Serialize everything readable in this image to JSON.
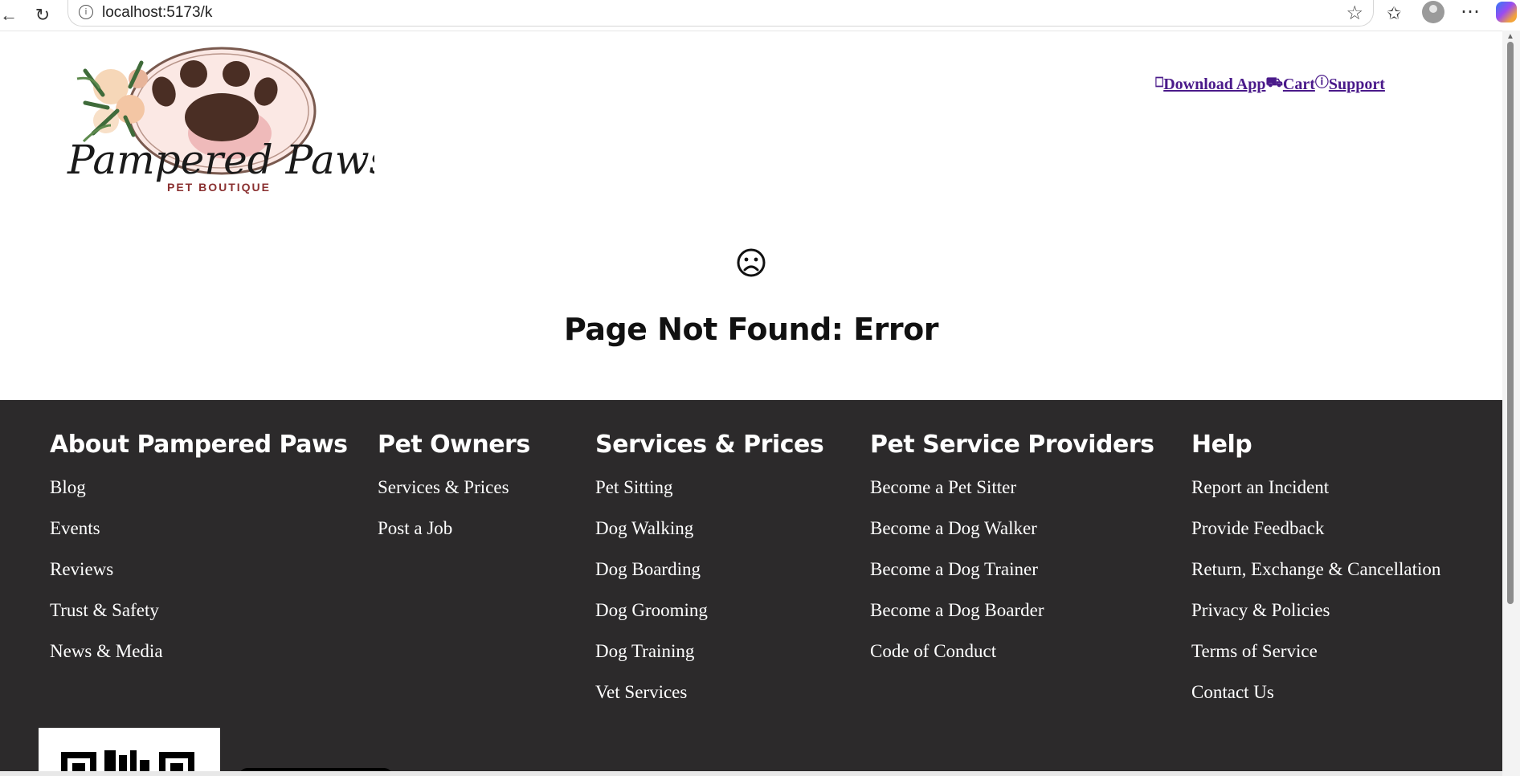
{
  "browser": {
    "url": "localhost:5173/k"
  },
  "header": {
    "logo_name": "Pampered Paws",
    "logo_sub": "PET BOUTIQUE",
    "links": [
      {
        "label": "Download App",
        "icon": "phone-icon"
      },
      {
        "label": "Cart",
        "icon": "cart-icon"
      },
      {
        "label": "Support",
        "icon": "help-circle-icon"
      }
    ]
  },
  "main": {
    "sad_icon": "sad-face-icon",
    "title": "Page Not Found: Error"
  },
  "footer": {
    "columns": [
      {
        "heading": "About Pampered Paws",
        "items": [
          "Blog",
          "Events",
          "Reviews",
          "Trust & Safety",
          "News & Media"
        ]
      },
      {
        "heading": "Pet Owners",
        "items": [
          "Services & Prices",
          "Post a Job"
        ]
      },
      {
        "heading": "Services & Prices",
        "items": [
          "Pet Sitting",
          "Dog Walking",
          "Dog Boarding",
          "Dog Grooming",
          "Dog Training",
          "Vet Services"
        ]
      },
      {
        "heading": "Pet Service Providers",
        "items": [
          "Become a Pet Sitter",
          "Become a Dog Walker",
          "Become a Dog Trainer",
          "Become a Dog Boarder",
          "Code of Conduct"
        ]
      },
      {
        "heading": "Help",
        "items": [
          "Report an Incident",
          "Provide Feedback",
          "Return, Exchange & Cancellation",
          "Privacy & Policies",
          "Terms of Service",
          "Contact Us"
        ]
      }
    ]
  },
  "colors": {
    "footer_bg": "#2c2a2b",
    "link": "#4a1a8a"
  }
}
